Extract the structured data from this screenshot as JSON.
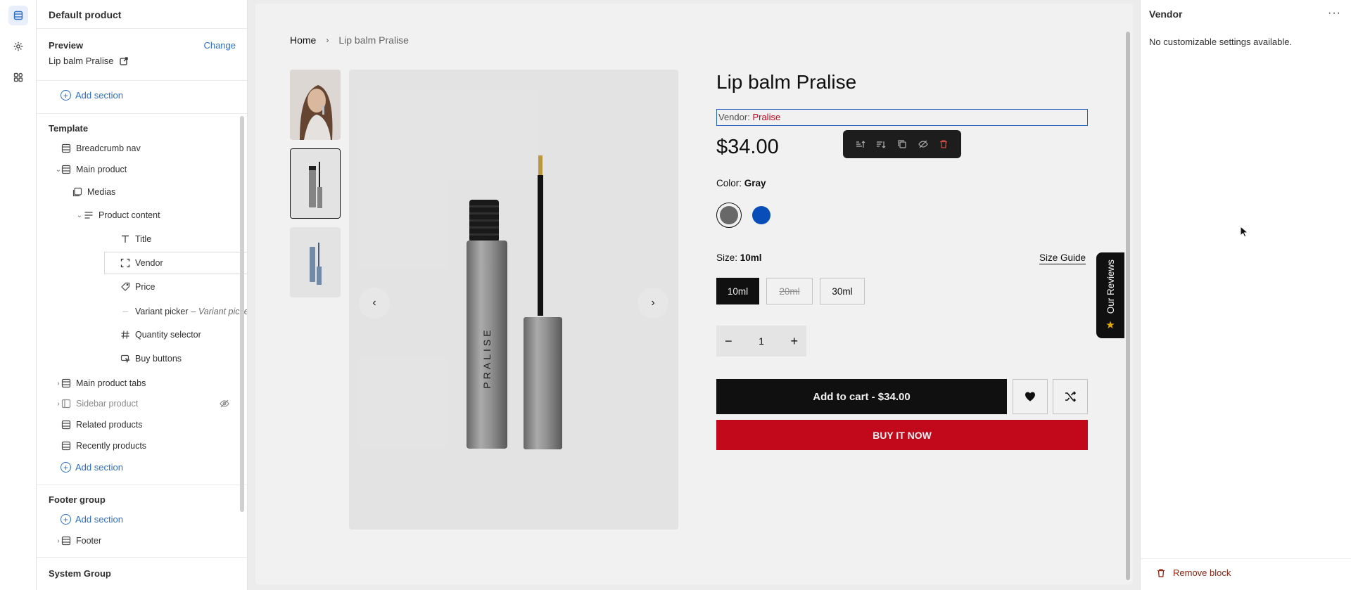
{
  "colors": {
    "accent": "#2c6ecb",
    "danger": "#ce0a1e",
    "vendor_name": "#d0021b",
    "swatch_gray": "#6f6f6f",
    "swatch_blue": "#0a52c4"
  },
  "rail": {
    "icons": [
      "sections-icon",
      "settings-gear-icon",
      "apps-icon"
    ]
  },
  "sidebar": {
    "title": "Default product",
    "preview": {
      "label": "Preview",
      "change": "Change",
      "value": "Lip balm Pralise"
    },
    "add_section": "Add section",
    "template": {
      "title": "Template",
      "items": [
        {
          "label": "Breadcrumb nav"
        },
        {
          "label": "Main product"
        },
        {
          "label": "Medias"
        },
        {
          "label": "Product content"
        },
        {
          "label": "Title"
        },
        {
          "label": "Vendor"
        },
        {
          "label": "Price"
        },
        {
          "label": "Variant picker",
          "sub": "– Variant picker"
        },
        {
          "label": "Quantity selector"
        },
        {
          "label": "Buy buttons"
        },
        {
          "label": "Main product tabs"
        },
        {
          "label": "Sidebar product"
        },
        {
          "label": "Related products"
        },
        {
          "label": "Recently products"
        }
      ]
    },
    "footer_group": {
      "title": "Footer group",
      "items": [
        {
          "label": "Footer"
        }
      ]
    },
    "system_group": {
      "title": "System Group"
    }
  },
  "canvas": {
    "breadcrumb": {
      "home": "Home",
      "separator": "›",
      "current": "Lip balm Pralise"
    },
    "product": {
      "title": "Lip balm Pralise",
      "vendor_label": "Vendor:",
      "vendor_name": "Pralise",
      "price": "$34.00",
      "color_label": "Color:",
      "color_value": "Gray",
      "size_label": "Size:",
      "size_value": "10ml",
      "size_guide": "Size Guide",
      "sizes": [
        "10ml",
        "20ml",
        "30ml"
      ],
      "quantity": "1",
      "add_to_cart": "Add to cart - $34.00",
      "buy_now": "BUY IT NOW",
      "bottle_text": "PRALISE"
    },
    "reviews_tab": "Our Reviews",
    "nav": {
      "prev": "‹",
      "next": "›"
    },
    "qty_minus": "−",
    "qty_plus": "+"
  },
  "rpanel": {
    "title": "Vendor",
    "more": "···",
    "message": "No customizable settings available.",
    "remove": "Remove block"
  }
}
